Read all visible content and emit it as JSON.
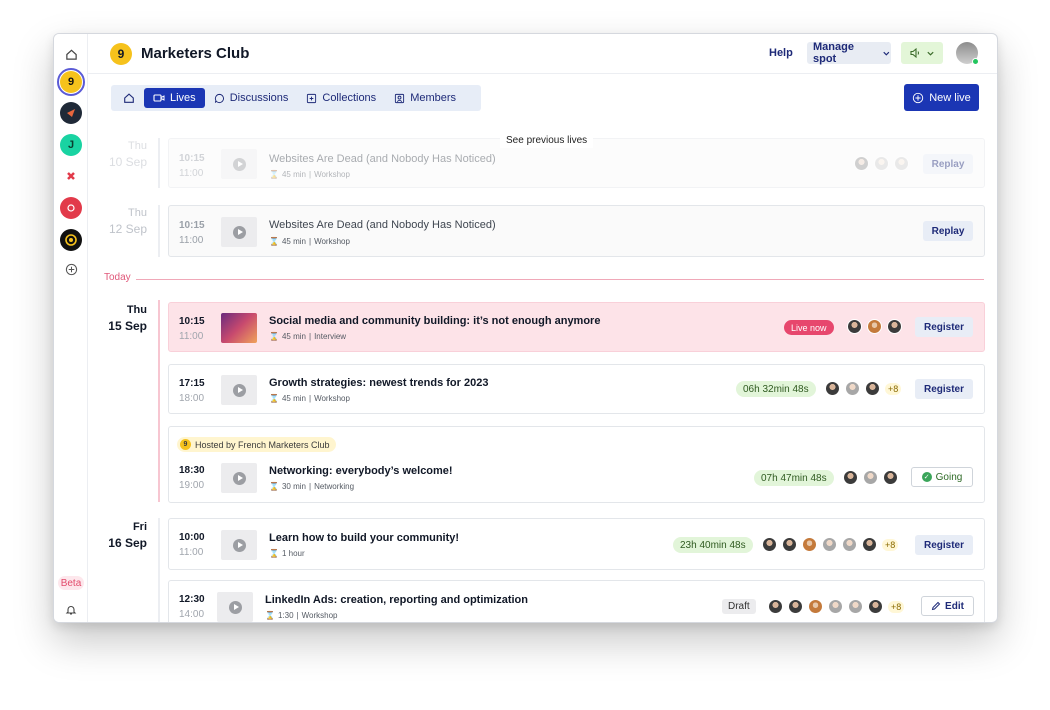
{
  "header": {
    "title": "Marketers Club",
    "help": "Help",
    "manage_spot": "Manage spot"
  },
  "tabs": [
    {
      "label": "Lives",
      "active": true
    },
    {
      "label": "Discussions"
    },
    {
      "label": "Collections"
    },
    {
      "label": "Members"
    }
  ],
  "new_live": "New live",
  "see_previous": "See previous lives",
  "today_label": "Today",
  "beta": "Beta",
  "days": {
    "d1": {
      "weekday": "Thu",
      "date": "10 Sep"
    },
    "d2": {
      "weekday": "Thu",
      "date": "12 Sep"
    },
    "d3": {
      "weekday": "Thu",
      "date": "15 Sep"
    },
    "d4": {
      "weekday": "Fri",
      "date": "16 Sep"
    }
  },
  "hosted_by": "Hosted by French Marketers Club",
  "events": [
    {
      "start": "10:15",
      "end": "11:00",
      "title": "Websites Are Dead (and Nobody Has Noticed)",
      "duration": "45 min",
      "type": "Workshop",
      "action": "Replay"
    },
    {
      "start": "10:15",
      "end": "11:00",
      "title": "Websites Are Dead (and Nobody Has Noticed)",
      "duration": "45 min",
      "type": "Workshop",
      "action": "Replay"
    },
    {
      "start": "10:15",
      "end": "11:00",
      "title": "Social media and community building: it’s not enough anymore",
      "duration": "45 min",
      "type": "Interview",
      "status": "Live now",
      "action": "Register"
    },
    {
      "start": "17:15",
      "end": "18:00",
      "title": "Growth strategies: newest trends for 2023",
      "duration": "45 min",
      "type": "Workshop",
      "timer": "06h 32min 48s",
      "more": "+8",
      "action": "Register"
    },
    {
      "start": "18:30",
      "end": "19:00",
      "title": "Networking: everybody’s welcome!",
      "duration": "30 min",
      "type": "Networking",
      "timer": "07h 47min 48s",
      "action": "Going"
    },
    {
      "start": "10:00",
      "end": "11:00",
      "title": "Learn how to build your community!",
      "duration": "1 hour",
      "timer": "23h 40min 48s",
      "more": "+8",
      "action": "Register"
    },
    {
      "start": "12:30",
      "end": "14:00",
      "title": "LinkedIn Ads: creation, reporting and optimization",
      "duration": "1:30",
      "type": "Workshop",
      "status": "Draft",
      "more": "+8",
      "action": "Edit"
    }
  ]
}
